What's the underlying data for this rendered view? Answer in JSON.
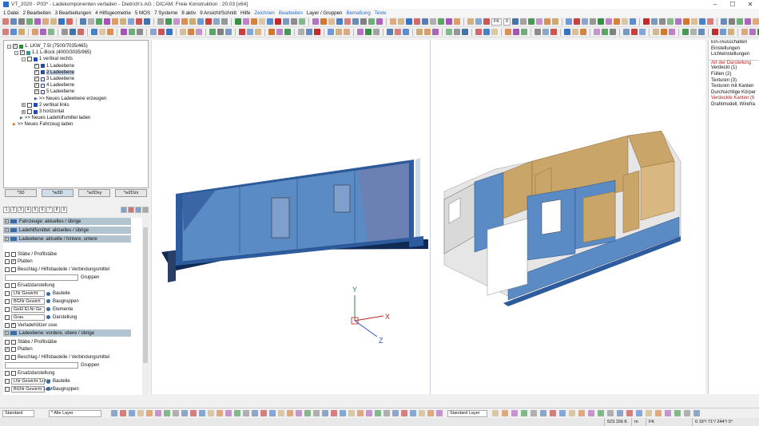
{
  "window": {
    "title": "VT_2020 - P03* - Ladekomponenten verladen - Dietrich's AG ; DICAM: Freie Konstruktion : 20.03 [x64]"
  },
  "menu": [
    {
      "label": "1 Datei",
      "hl": false
    },
    {
      "label": "2 Bearbeiten",
      "hl": false
    },
    {
      "label": "3 Bearbeitungen",
      "hl": false
    },
    {
      "label": "4 Hilfsgeometrie",
      "hl": false
    },
    {
      "label": "5 MOS",
      "hl": false
    },
    {
      "label": "7 Systeme",
      "hl": false
    },
    {
      "label": "8 aktiv",
      "hl": false
    },
    {
      "label": "9 Ansicht/Schnitt",
      "hl": false
    },
    {
      "label": "Hilfe",
      "hl": false
    },
    {
      "label": "Zeichnen",
      "hl": true
    },
    {
      "label": "Bearbeiten",
      "hl": true
    },
    {
      "label": "Layer / Gruppen",
      "hl": false
    },
    {
      "label": "Bemaßung",
      "hl": true
    },
    {
      "label": "Texte",
      "hl": true
    }
  ],
  "toolbar": {
    "fk_label": "FK",
    "value_field": "0"
  },
  "tree": [
    {
      "label": "1. LKW_7.5t (7500/7035/465)",
      "indent": 0,
      "exp": "-",
      "check": true,
      "sq": "#2a8a3a",
      "sel": false
    },
    {
      "label": "1.1 L-Bock (4000/3035/965)",
      "indent": 1,
      "exp": "-",
      "check": true,
      "sq": "#2a9a9a",
      "sel": false
    },
    {
      "label": "1 vertikal rechts",
      "indent": 2,
      "exp": "-",
      "check": false,
      "sq": "#1f4fa8",
      "sel": false
    },
    {
      "label": "1 Ladeebene",
      "indent": 3,
      "exp": "",
      "check": true,
      "sq": "#1f4fa8",
      "sel": false
    },
    {
      "label": "2 Ladeebene",
      "indent": 3,
      "exp": "",
      "check": true,
      "sq": "#1f4fa8",
      "sel": true
    },
    {
      "label": "3 Ladeebene",
      "indent": 3,
      "exp": "",
      "check": true,
      "sq": "#ffffff",
      "sel": false
    },
    {
      "label": "4 Ladeebene",
      "indent": 3,
      "exp": "",
      "check": true,
      "sq": "#ffffff",
      "sel": false
    },
    {
      "label": "5 Ladeebene",
      "indent": 3,
      "exp": "",
      "check": true,
      "sq": "#ffffff",
      "sel": false
    },
    {
      "label": ">> Neues Ladeebene erzeugen",
      "indent": 3,
      "exp": "",
      "check": null,
      "sq": "#1f4fa8",
      "sel": false
    },
    {
      "label": "2 vertikal links",
      "indent": 2,
      "exp": "+",
      "check": false,
      "sq": "#1f4fa8",
      "sel": false
    },
    {
      "label": "3 horizontal",
      "indent": 2,
      "exp": "+",
      "check": false,
      "sq": "#1f4fa8",
      "sel": false
    },
    {
      "label": ">> Neues Ladehilfsmittel laden",
      "indent": 1,
      "exp": "",
      "check": null,
      "sq": "#2a8a3a",
      "sel": false
    },
    {
      "label": ">> Neues Fahrzeug laden",
      "indent": 0,
      "exp": "",
      "check": null,
      "sq": "#d07020",
      "sel": false
    }
  ],
  "view_tabs": [
    "*3D",
    "*w3D",
    "*w2Dxy",
    "*w2Dzx"
  ],
  "numbar": [
    "1",
    "2",
    "3",
    "4",
    "5",
    "6",
    "7",
    "8",
    "9"
  ],
  "props": [
    {
      "type": "hdr",
      "label": "Fahrzeuge: aktuelles / übrige"
    },
    {
      "type": "hdr",
      "label": "Ladehilfsmittel: aktuelles / übrige"
    },
    {
      "type": "hdr",
      "label": "Ladeebene: aktuelle / hintere, untere"
    },
    {
      "type": "gap"
    },
    {
      "type": "chk",
      "c1": false,
      "c2": false,
      "label": "Stäbe / Profilstäbe"
    },
    {
      "type": "chk",
      "c1": false,
      "c2": true,
      "label": "Platten"
    },
    {
      "type": "chk",
      "c1": false,
      "c2": false,
      "label": "Beschlag / Hilfsbauteile / Verbindungsmittel"
    },
    {
      "type": "field",
      "label": "Gruppen"
    },
    {
      "type": "chk",
      "c1": false,
      "c2": false,
      "label": "Ersatzdarstellung"
    },
    {
      "type": "combo",
      "c1": false,
      "value": "LNr Gewicht",
      "label": "Bauteile"
    },
    {
      "type": "combo",
      "c1": false,
      "value": "BGNr Gewich",
      "label": "Baugruppen"
    },
    {
      "type": "combo",
      "c1": false,
      "value": "GeEl ELNr Ge",
      "label": "Elemente"
    },
    {
      "type": "combo",
      "c1": false,
      "value": "Grau",
      "label": "Darstellung"
    },
    {
      "type": "chk",
      "c1": false,
      "c2": true,
      "label": "Verladehölzer usw."
    },
    {
      "type": "hdr",
      "label": "Ladeebene: vordere, obere / übrige"
    },
    {
      "type": "chk",
      "c1": false,
      "c2": false,
      "label": "Stäbe / Profilstäbe"
    },
    {
      "type": "chk",
      "c1": true,
      "c2": false,
      "label": "Platten"
    },
    {
      "type": "chk",
      "c1": false,
      "c2": false,
      "label": "Beschlag / Hilfsbauteile / Verbindungsmittel"
    },
    {
      "type": "field",
      "label": "Gruppen"
    },
    {
      "type": "chk",
      "c1": false,
      "c2": false,
      "label": "Ersatzdarstellung"
    },
    {
      "type": "combo",
      "c1": false,
      "value": "LNr Gewicht 1z Mit",
      "label": "Bauteile"
    },
    {
      "type": "combo",
      "c1": false,
      "value": "BGNr Gewicht 1z M",
      "label": "Baugruppen"
    }
  ],
  "right_panel": [
    {
      "label": "Ein-/Ausschalten",
      "red": false,
      "line": false
    },
    {
      "label": "Einstellungen",
      "red": false,
      "line": false
    },
    {
      "label": "Lichteinstellungen",
      "red": false,
      "line": false
    },
    {
      "label": "Art der Darstellung",
      "red": true,
      "line": true
    },
    {
      "label": "Verdeckt (1)",
      "red": false,
      "line": false
    },
    {
      "label": "Füllen (2)",
      "red": false,
      "line": false
    },
    {
      "label": "Texturen (3)",
      "red": false,
      "line": false
    },
    {
      "label": "Texturen mit Kanten",
      "red": false,
      "line": false
    },
    {
      "label": "Durchsichtige Körper",
      "red": false,
      "line": false
    },
    {
      "label": "Verdeckte Kanten (6",
      "red": true,
      "line": false
    },
    {
      "label": "Drahtmodell, Wirefra",
      "red": false,
      "line": false
    }
  ],
  "axes": {
    "x": "X",
    "y": "Y",
    "z": "Z"
  },
  "bottom": {
    "style_value": "Standard",
    "layer_value": "* Alle Layer",
    "std_layer": "Standard Layer"
  },
  "status": {
    "coord": "523.156 K",
    "m": "m",
    "fk": "FK",
    "angle": "0 19°/ 71°/ 244°/ 0°"
  },
  "colors": {
    "plate_blue": "#5b8bc4",
    "wood": "#c9a56a",
    "accent": "#2b6cc4"
  }
}
